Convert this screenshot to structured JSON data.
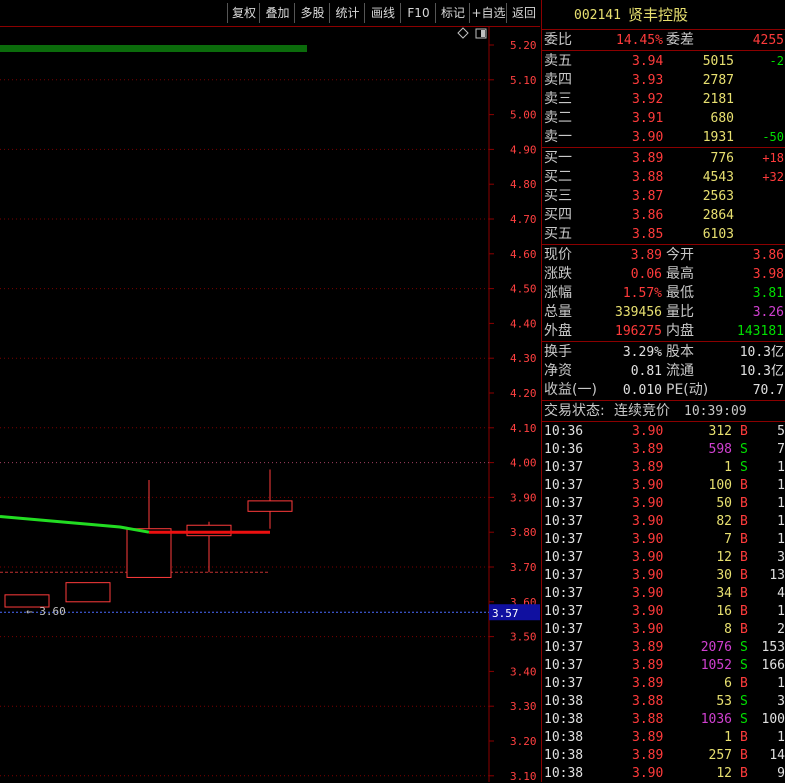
{
  "toolbar": {
    "buttons": [
      "复权",
      "叠加",
      "多股",
      "统计",
      "画线",
      "F10",
      "标记",
      "+自选",
      "返回"
    ]
  },
  "header": {
    "code": "002141",
    "name": "贤丰控股"
  },
  "chart": {
    "price_ticks": [
      "5.20",
      "5.10",
      "5.00",
      "4.90",
      "4.80",
      "4.70",
      "4.60",
      "4.50",
      "4.40",
      "4.30",
      "4.20",
      "4.10",
      "4.00",
      "3.90",
      "3.80",
      "3.70",
      "3.60",
      "3.50",
      "3.40",
      "3.30",
      "3.20",
      "3.10"
    ],
    "current_price_tag": "3.57",
    "low_marker_label": "← 3.60",
    "icons": [
      "diamond-icon",
      "panel-toggle-icon"
    ]
  },
  "quote": {
    "weibi_label": "委比",
    "weibi_value": "14.45%",
    "weicha_label": "委差",
    "weicha_value": "4255",
    "asks": [
      {
        "label": "卖五",
        "price": "3.94",
        "vol": "5015",
        "chg": "-2"
      },
      {
        "label": "卖四",
        "price": "3.93",
        "vol": "2787",
        "chg": ""
      },
      {
        "label": "卖三",
        "price": "3.92",
        "vol": "2181",
        "chg": ""
      },
      {
        "label": "卖二",
        "price": "3.91",
        "vol": "680",
        "chg": ""
      },
      {
        "label": "卖一",
        "price": "3.90",
        "vol": "1931",
        "chg": "-50"
      }
    ],
    "bids": [
      {
        "label": "买一",
        "price": "3.89",
        "vol": "776",
        "chg": "+18"
      },
      {
        "label": "买二",
        "price": "3.88",
        "vol": "4543",
        "chg": "+32"
      },
      {
        "label": "买三",
        "price": "3.87",
        "vol": "2563",
        "chg": ""
      },
      {
        "label": "买四",
        "price": "3.86",
        "vol": "2864",
        "chg": ""
      },
      {
        "label": "买五",
        "price": "3.85",
        "vol": "6103",
        "chg": ""
      }
    ],
    "stats": [
      {
        "l1": "现价",
        "v1": "3.89",
        "l2": "今开",
        "v2": "3.86"
      },
      {
        "l1": "涨跌",
        "v1": "0.06",
        "l2": "最高",
        "v2": "3.98"
      },
      {
        "l1": "涨幅",
        "v1": "1.57%",
        "l2": "最低",
        "v2": "3.81"
      },
      {
        "l1": "总量",
        "v1": "339456",
        "l2": "量比",
        "v2": "3.26"
      },
      {
        "l1": "外盘",
        "v1": "196275",
        "l2": "内盘",
        "v2": "143181"
      }
    ],
    "fund": [
      {
        "l1": "换手",
        "v1": "3.29%",
        "l2": "股本",
        "v2": "10.3亿"
      },
      {
        "l1": "净资",
        "v1": "0.81",
        "l2": "流通",
        "v2": "10.3亿"
      },
      {
        "l1": "收益(一)",
        "v1": "0.010",
        "l2": "PE(动)",
        "v2": "70.7"
      }
    ],
    "status_label": "交易状态:",
    "status_value": "连续竞价",
    "status_time": "10:39:09"
  },
  "trades": [
    {
      "t": "10:36",
      "p": "3.90",
      "v": "312",
      "s": "B",
      "n": "5"
    },
    {
      "t": "10:36",
      "p": "3.89",
      "v": "598",
      "s": "S",
      "n": "7"
    },
    {
      "t": "10:37",
      "p": "3.89",
      "v": "1",
      "s": "S",
      "n": "1"
    },
    {
      "t": "10:37",
      "p": "3.90",
      "v": "100",
      "s": "B",
      "n": "1"
    },
    {
      "t": "10:37",
      "p": "3.90",
      "v": "50",
      "s": "B",
      "n": "1"
    },
    {
      "t": "10:37",
      "p": "3.90",
      "v": "82",
      "s": "B",
      "n": "1"
    },
    {
      "t": "10:37",
      "p": "3.90",
      "v": "7",
      "s": "B",
      "n": "1"
    },
    {
      "t": "10:37",
      "p": "3.90",
      "v": "12",
      "s": "B",
      "n": "3"
    },
    {
      "t": "10:37",
      "p": "3.90",
      "v": "30",
      "s": "B",
      "n": "13"
    },
    {
      "t": "10:37",
      "p": "3.90",
      "v": "34",
      "s": "B",
      "n": "4"
    },
    {
      "t": "10:37",
      "p": "3.90",
      "v": "16",
      "s": "B",
      "n": "1"
    },
    {
      "t": "10:37",
      "p": "3.90",
      "v": "8",
      "s": "B",
      "n": "2"
    },
    {
      "t": "10:37",
      "p": "3.89",
      "v": "2076",
      "s": "S",
      "n": "153"
    },
    {
      "t": "10:37",
      "p": "3.89",
      "v": "1052",
      "s": "S",
      "n": "166"
    },
    {
      "t": "10:37",
      "p": "3.89",
      "v": "6",
      "s": "B",
      "n": "1"
    },
    {
      "t": "10:38",
      "p": "3.88",
      "v": "53",
      "s": "S",
      "n": "3"
    },
    {
      "t": "10:38",
      "p": "3.88",
      "v": "1036",
      "s": "S",
      "n": "100"
    },
    {
      "t": "10:38",
      "p": "3.89",
      "v": "1",
      "s": "B",
      "n": "1"
    },
    {
      "t": "10:38",
      "p": "3.89",
      "v": "257",
      "s": "B",
      "n": "14"
    },
    {
      "t": "10:38",
      "p": "3.90",
      "v": "12",
      "s": "B",
      "n": "9"
    }
  ],
  "colors": {
    "up": "#ff3b3b",
    "down": "#00e000",
    "grid": "#8b0000",
    "ma": "#33dd33"
  }
}
